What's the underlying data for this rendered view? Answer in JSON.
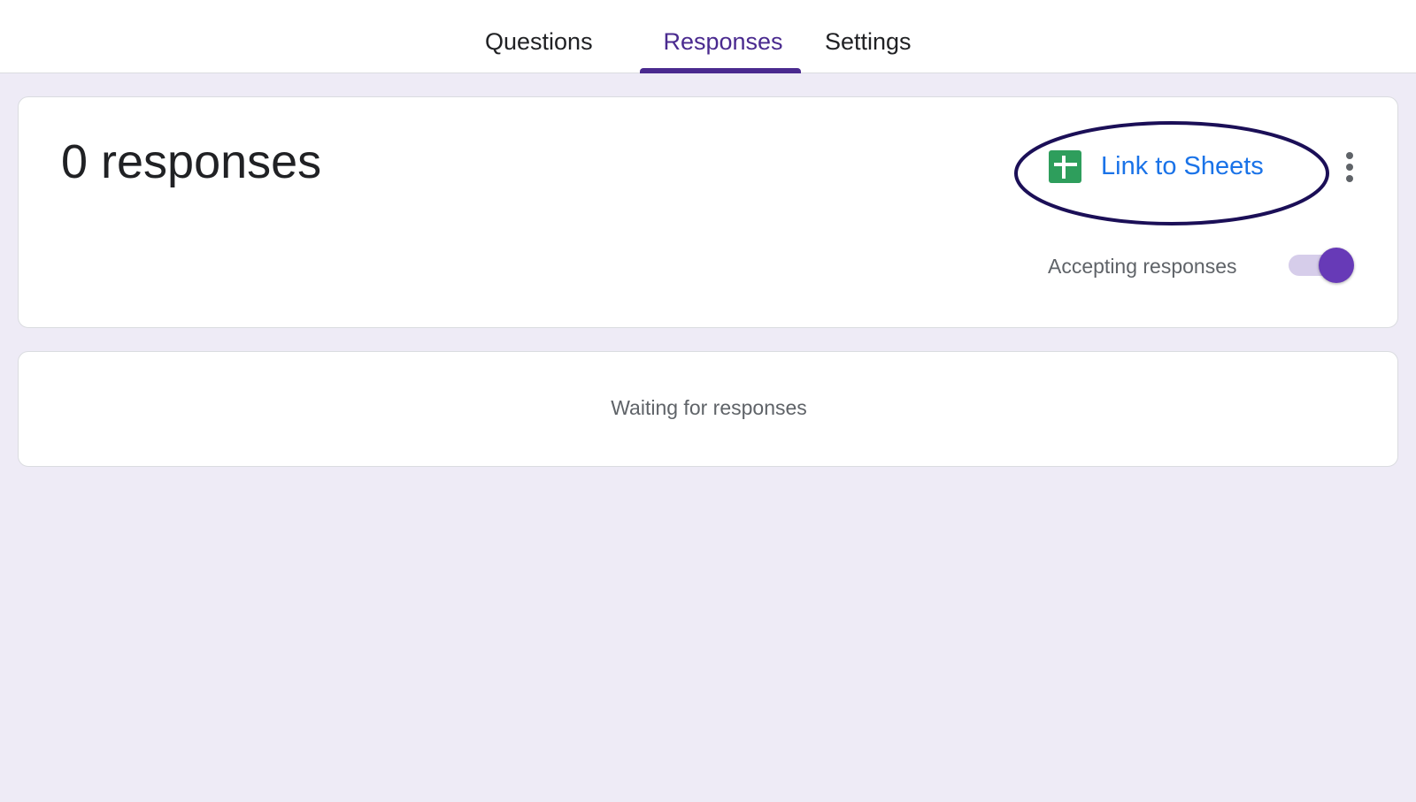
{
  "tabs": {
    "questions": "Questions",
    "responses": "Responses",
    "settings": "Settings"
  },
  "summary": {
    "count_text": "0 responses",
    "link_sheets_label": "Link to Sheets",
    "accepting_label": "Accepting responses",
    "accepting_on": true
  },
  "waiting": {
    "text": "Waiting for responses"
  },
  "icons": {
    "sheets": "google-sheets-icon",
    "more": "more-vert-icon"
  },
  "colors": {
    "accent": "#673ab7",
    "tab_active": "#4a2a8f",
    "link": "#1a73e8",
    "sheets_green": "#2e9e5c",
    "background": "#eeebf6",
    "annotation_ellipse": "#1b0f57"
  }
}
